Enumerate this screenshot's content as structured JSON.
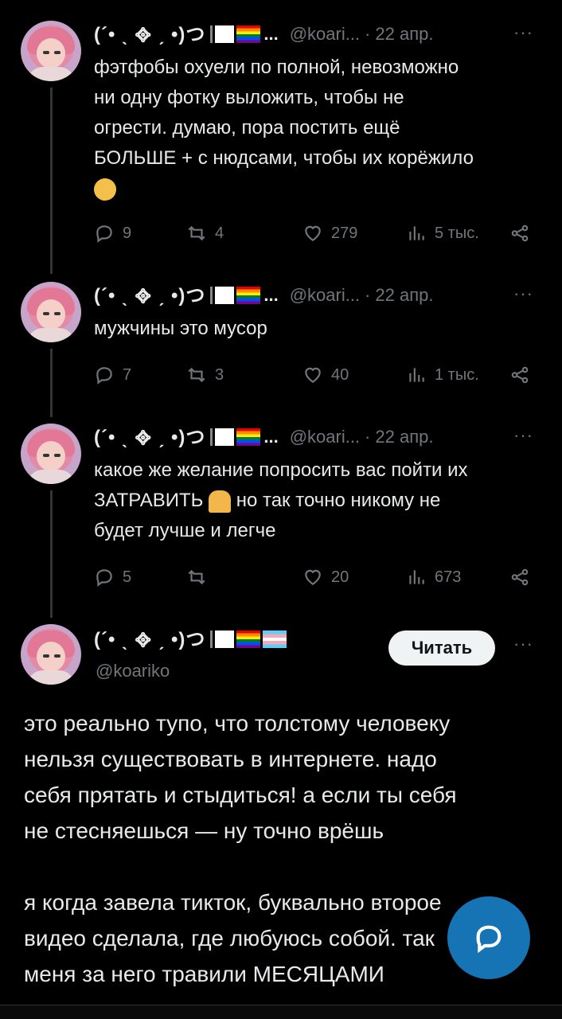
{
  "tweets": [
    {
      "name": "(´• ˎ ᪣ ˏ •)つ",
      "handle": "@koari...",
      "date": "22 апр.",
      "text_lines": [
        "фэтфобы охуели по полной, невозможно",
        "ни одну фотку выложить, чтобы не",
        "огрести. думаю, пора постить ещё",
        "БОЛЬШЕ + с нюдсами, чтобы их корёжило"
      ],
      "emoji": "smiling-face-with-hearts",
      "replies": "9",
      "retweets": "4",
      "likes": "279",
      "views": "5 тыс."
    },
    {
      "name": "(´• ˎ ᪣ ˏ •)つ",
      "handle": "@koari...",
      "date": "22 апр.",
      "text_lines": [
        "мужчины это мусор"
      ],
      "replies": "7",
      "retweets": "3",
      "likes": "40",
      "views": "1 тыс."
    },
    {
      "name": "(´• ˎ ᪣ ˏ •)つ",
      "handle": "@koari...",
      "date": "22 апр.",
      "text_lines": [
        "какое же желание попросить вас пойти их",
        "ЗАТРАВИТЬ",
        "но так точно никому не",
        "будет лучше и легче"
      ],
      "emoji": "folded-hands",
      "replies": "5",
      "retweets": "",
      "likes": "20",
      "views": "673"
    }
  ],
  "main": {
    "name": "(´• ˎ ᪣ ˏ •)つ",
    "handle": "@koariko",
    "follow_label": "Читать",
    "paragraphs": [
      [
        "это реально тупо, что толстому человеку",
        "нельзя существовать в интернете. надо",
        "себя прятать и стыдиться! а если ты себя",
        "не стесняешься — ну точно врёшь"
      ],
      [
        "я когда завела тикток, буквально второе",
        "видео сделала, где любуюсь собой. так",
        "меня за него травили МЕСЯЦАМИ"
      ]
    ]
  },
  "ui": {
    "ellipsis": "...",
    "more": "···",
    "dot": "·"
  },
  "colors": {
    "background": "#000000",
    "text": "#e7e9ea",
    "muted": "#71767b",
    "accent": "#1d9bf0"
  }
}
